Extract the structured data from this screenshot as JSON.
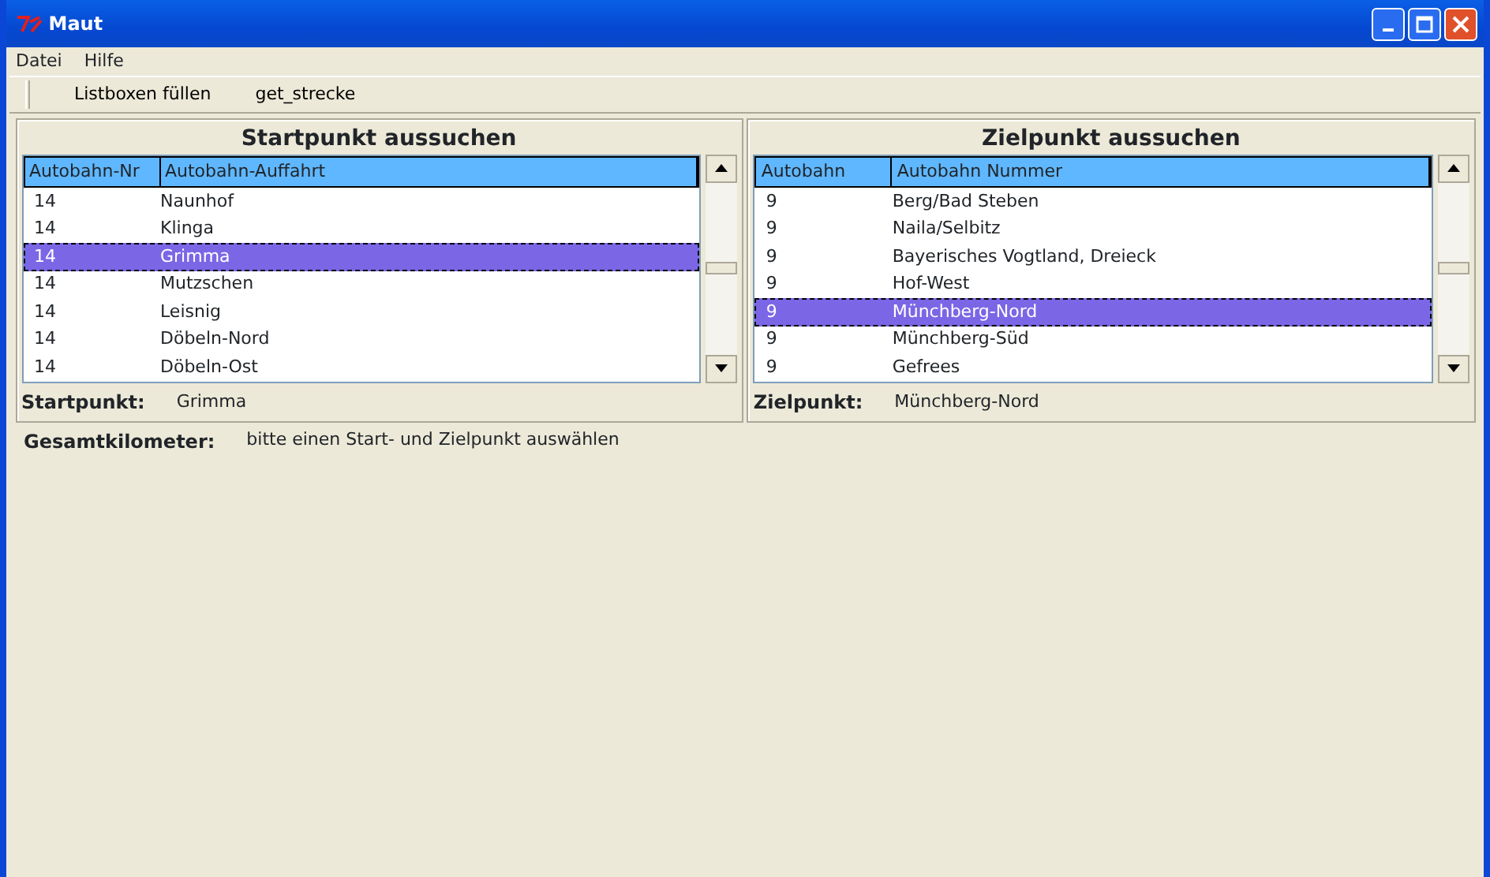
{
  "window": {
    "title": "Maut"
  },
  "menu": [
    "Datei",
    "Hilfe"
  ],
  "toolbar": [
    "Listboxen füllen",
    "get_strecke"
  ],
  "panels": [
    {
      "title": "Startpunkt aussuchen",
      "columns": [
        "Autobahn-Nr",
        "Autobahn-Auffahrt"
      ],
      "rows": [
        {
          "cells": [
            "14",
            "Naunhof"
          ],
          "selected": false
        },
        {
          "cells": [
            "14",
            "Klinga"
          ],
          "selected": false
        },
        {
          "cells": [
            "14",
            "Grimma"
          ],
          "selected": true
        },
        {
          "cells": [
            "14",
            "Mutzschen"
          ],
          "selected": false
        },
        {
          "cells": [
            "14",
            "Leisnig"
          ],
          "selected": false
        },
        {
          "cells": [
            "14",
            "Döbeln-Nord"
          ],
          "selected": false
        },
        {
          "cells": [
            "14",
            "Döbeln-Ost"
          ],
          "selected": false
        }
      ],
      "result_label": "Startpunkt:",
      "result_value": "Grimma"
    },
    {
      "title": "Zielpunkt aussuchen",
      "columns": [
        "Autobahn",
        "Autobahn Nummer"
      ],
      "rows": [
        {
          "cells": [
            "9",
            "Berg/Bad Steben"
          ],
          "selected": false
        },
        {
          "cells": [
            "9",
            "Naila/Selbitz"
          ],
          "selected": false
        },
        {
          "cells": [
            "9",
            "Bayerisches Vogtland, Dreieck"
          ],
          "selected": false
        },
        {
          "cells": [
            "9",
            "Hof-West"
          ],
          "selected": false
        },
        {
          "cells": [
            "9",
            "Münchberg-Nord"
          ],
          "selected": true
        },
        {
          "cells": [
            "9",
            "Münchberg-Süd"
          ],
          "selected": false
        },
        {
          "cells": [
            "9",
            "Gefrees"
          ],
          "selected": false
        }
      ],
      "result_label": "Zielpunkt:",
      "result_value": "Münchberg-Nord"
    }
  ],
  "total": {
    "label": "Gesamtkilometer:",
    "value": "bitte einen Start- und Zielpunkt auswählen"
  }
}
